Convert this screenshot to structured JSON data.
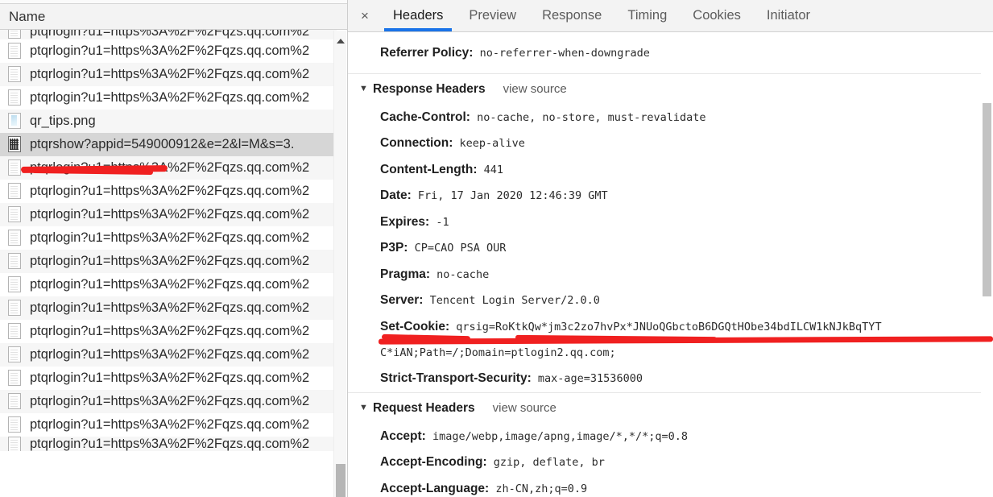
{
  "left_panel": {
    "column_header": "Name",
    "rows": [
      {
        "label": "ptqrlogin?u1=https%3A%2F%2Fqzs.qq.com%2",
        "icon": "document-icon",
        "state": "clipped-top",
        "selected": false
      },
      {
        "label": "ptqrlogin?u1=https%3A%2F%2Fqzs.qq.com%2",
        "icon": "document-icon",
        "state": "normal",
        "selected": false
      },
      {
        "label": "ptqrlogin?u1=https%3A%2F%2Fqzs.qq.com%2",
        "icon": "document-icon",
        "state": "normal",
        "selected": false
      },
      {
        "label": "ptqrlogin?u1=https%3A%2F%2Fqzs.qq.com%2",
        "icon": "document-icon",
        "state": "normal",
        "selected": false
      },
      {
        "label": "qr_tips.png",
        "icon": "image-icon",
        "state": "normal",
        "selected": false
      },
      {
        "label": "ptqrshow?appid=549000912&e=2&l=M&s=3.",
        "icon": "qrcode-icon",
        "state": "normal",
        "selected": true
      },
      {
        "label": "ptqrlogin?u1=https%3A%2F%2Fqzs.qq.com%2",
        "icon": "document-icon",
        "state": "normal",
        "selected": false
      },
      {
        "label": "ptqrlogin?u1=https%3A%2F%2Fqzs.qq.com%2",
        "icon": "document-icon",
        "state": "normal",
        "selected": false
      },
      {
        "label": "ptqrlogin?u1=https%3A%2F%2Fqzs.qq.com%2",
        "icon": "document-icon",
        "state": "normal",
        "selected": false
      },
      {
        "label": "ptqrlogin?u1=https%3A%2F%2Fqzs.qq.com%2",
        "icon": "document-icon",
        "state": "normal",
        "selected": false
      },
      {
        "label": "ptqrlogin?u1=https%3A%2F%2Fqzs.qq.com%2",
        "icon": "document-icon",
        "state": "normal",
        "selected": false
      },
      {
        "label": "ptqrlogin?u1=https%3A%2F%2Fqzs.qq.com%2",
        "icon": "document-icon",
        "state": "normal",
        "selected": false
      },
      {
        "label": "ptqrlogin?u1=https%3A%2F%2Fqzs.qq.com%2",
        "icon": "document-icon",
        "state": "normal",
        "selected": false
      },
      {
        "label": "ptqrlogin?u1=https%3A%2F%2Fqzs.qq.com%2",
        "icon": "document-icon",
        "state": "normal",
        "selected": false
      },
      {
        "label": "ptqrlogin?u1=https%3A%2F%2Fqzs.qq.com%2",
        "icon": "document-icon",
        "state": "normal",
        "selected": false
      },
      {
        "label": "ptqrlogin?u1=https%3A%2F%2Fqzs.qq.com%2",
        "icon": "document-icon",
        "state": "normal",
        "selected": false
      },
      {
        "label": "ptqrlogin?u1=https%3A%2F%2Fqzs.qq.com%2",
        "icon": "document-icon",
        "state": "normal",
        "selected": false
      },
      {
        "label": "ptqrlogin?u1=https%3A%2F%2Fqzs.qq.com%2",
        "icon": "document-icon",
        "state": "normal",
        "selected": false
      },
      {
        "label": "ptqrlogin?u1=https%3A%2F%2Fqzs.qq.com%2",
        "icon": "document-icon",
        "state": "clipped-bottom",
        "selected": false
      }
    ],
    "scrollbar": {
      "up_arrow": "scroll-up-arrow"
    }
  },
  "right_panel": {
    "close_label": "×",
    "tabs": [
      {
        "label": "Headers",
        "active": true
      },
      {
        "label": "Preview",
        "active": false
      },
      {
        "label": "Response",
        "active": false
      },
      {
        "label": "Timing",
        "active": false
      },
      {
        "label": "Cookies",
        "active": false
      },
      {
        "label": "Initiator",
        "active": false
      }
    ],
    "referrer": {
      "key": "Referrer Policy:",
      "value": "no-referrer-when-downgrade"
    },
    "response_section": {
      "title": "Response Headers",
      "view_source": "view source",
      "caret": "▼",
      "headers": [
        {
          "key": "Cache-Control:",
          "value": "no-cache, no-store, must-revalidate"
        },
        {
          "key": "Connection:",
          "value": "keep-alive"
        },
        {
          "key": "Content-Length:",
          "value": "441"
        },
        {
          "key": "Date:",
          "value": "Fri, 17 Jan 2020 12:46:39 GMT"
        },
        {
          "key": "Expires:",
          "value": "-1"
        },
        {
          "key": "P3P:",
          "value": "CP=CAO PSA OUR"
        },
        {
          "key": "Pragma:",
          "value": "no-cache"
        },
        {
          "key": "Server:",
          "value": "Tencent Login Server/2.0.0"
        },
        {
          "key": "Set-Cookie:",
          "value": "qrsig=RoKtkQw*jm3c2zo7hvPx*JNUoQGbctoB6DGQtHObe34bdILCW1kNJkBqTYT",
          "continuation": "C*iAN;Path=/;Domain=ptlogin2.qq.com;"
        },
        {
          "key": "Strict-Transport-Security:",
          "value": "max-age=31536000"
        }
      ]
    },
    "request_section": {
      "title": "Request Headers",
      "view_source": "view source",
      "caret": "▼",
      "headers": [
        {
          "key": "Accept:",
          "value": "image/webp,image/apng,image/*,*/*;q=0.8"
        },
        {
          "key": "Accept-Encoding:",
          "value": "gzip, deflate, br"
        },
        {
          "key": "Accept-Language:",
          "value": "zh-CN,zh;q=0.9"
        }
      ]
    }
  },
  "annotations": {
    "color": "#f02020",
    "marks": [
      {
        "name": "underline-selected-request",
        "target": "ptqrshow?appid=549000912&e=2&l=M&s=3."
      },
      {
        "name": "underline-set-cookie",
        "target": "Set-Cookie: qrsig=..."
      }
    ]
  },
  "theme": {
    "accent_blue": "#1a73e8",
    "selected_row_bg": "#d6d6d6",
    "header_bg": "#f3f3f3"
  }
}
